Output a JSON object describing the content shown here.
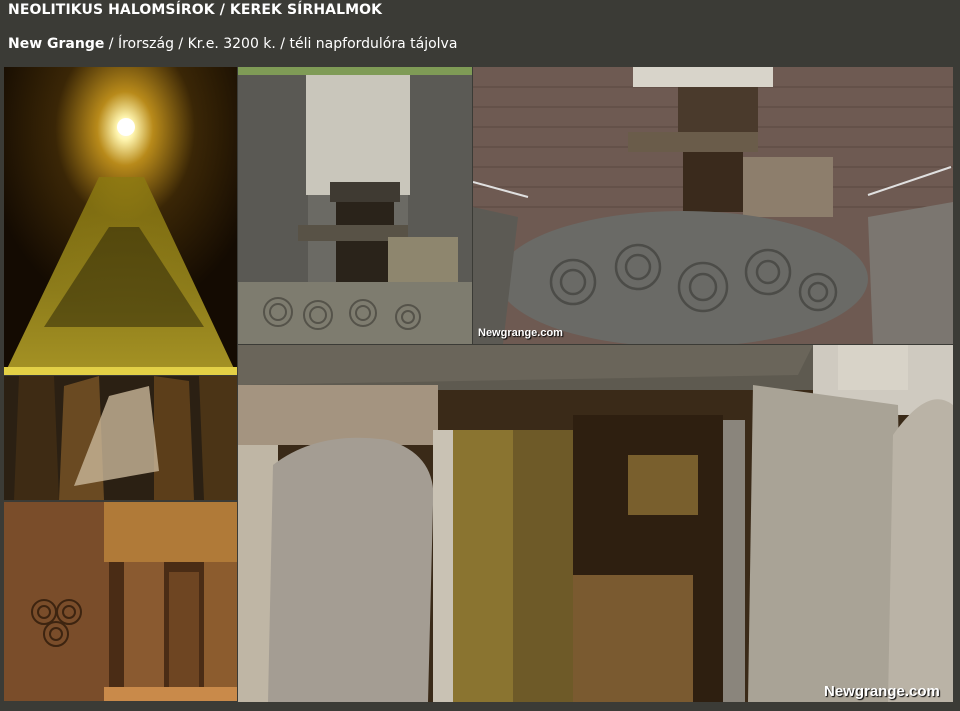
{
  "header": {
    "title": "NEOLITIKUS HALOMSÍROK / KEREK SÍRHALMOK",
    "subtitle_bold": "New Grange",
    "subtitle_rest": " / Írország / Kr.e. 3200 k. / téli napfordulóra tájolva"
  },
  "watermarks": {
    "top_right": "Newgrange.com",
    "bottom_right": "Newgrange.com"
  },
  "colors": {
    "background": "#3b3b36",
    "text": "#ffffff"
  }
}
